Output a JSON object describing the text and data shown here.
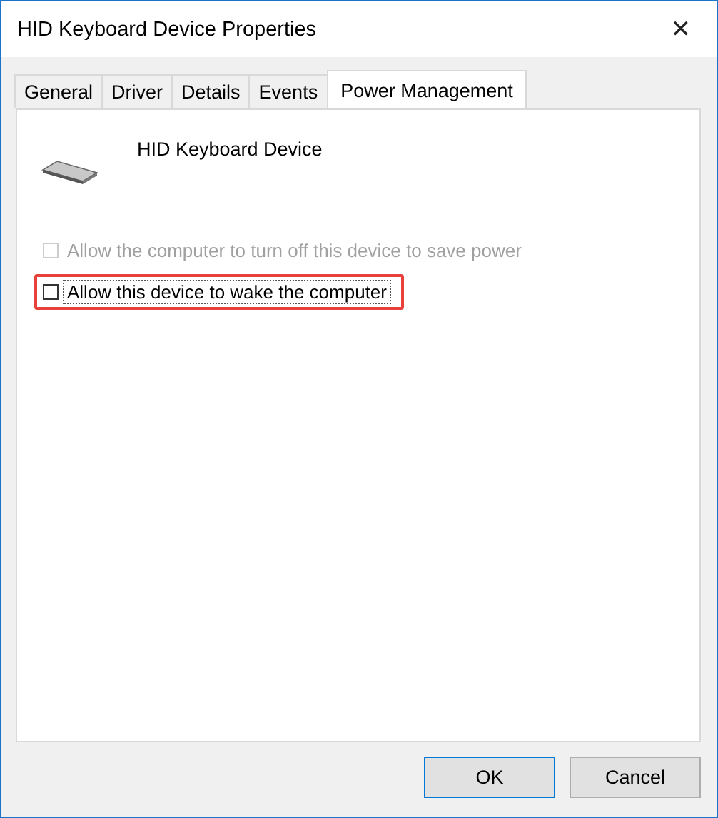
{
  "window": {
    "title": "HID Keyboard Device Properties",
    "close": "✕"
  },
  "tabs": [
    {
      "label": "General",
      "selected": false
    },
    {
      "label": "Driver",
      "selected": false
    },
    {
      "label": "Details",
      "selected": false
    },
    {
      "label": "Events",
      "selected": false
    },
    {
      "label": "Power Management",
      "selected": true
    }
  ],
  "device": {
    "name": "HID Keyboard Device"
  },
  "options": [
    {
      "label": "Allow the computer to turn off this device to save power",
      "checked": false,
      "disabled": true,
      "highlighted": false,
      "focused": false
    },
    {
      "label": "Allow this device to wake the computer",
      "checked": false,
      "disabled": false,
      "highlighted": true,
      "focused": true
    }
  ],
  "buttons": [
    {
      "label": "OK",
      "default": true
    },
    {
      "label": "Cancel",
      "default": false
    }
  ]
}
